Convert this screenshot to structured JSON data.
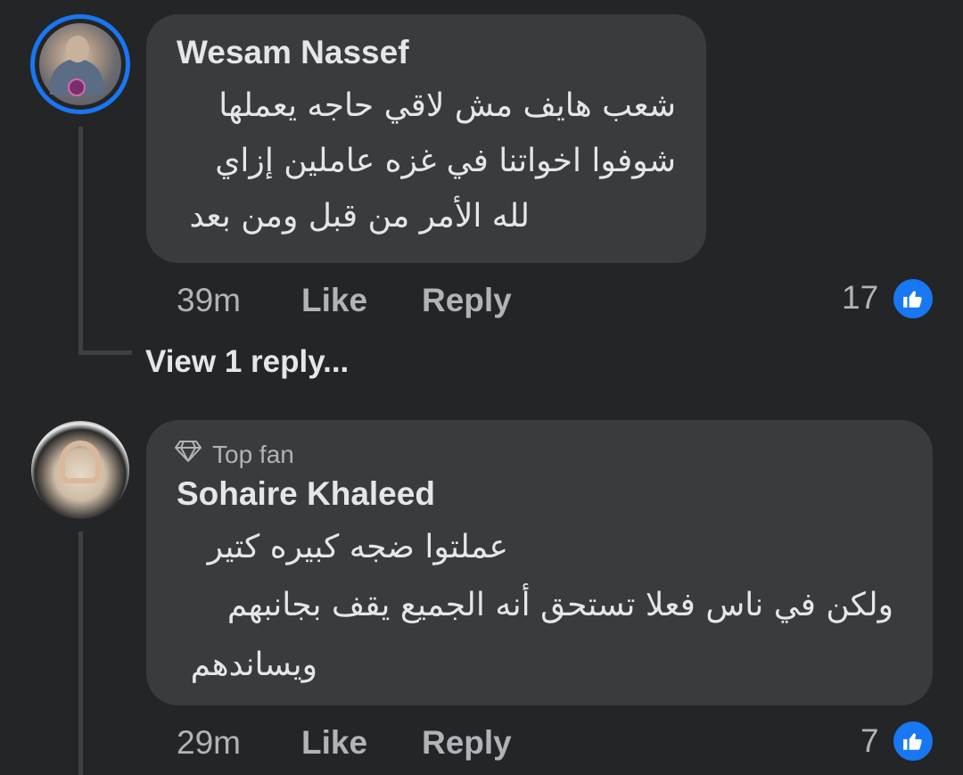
{
  "comments": [
    {
      "author": "Wesam Nassef",
      "lines": [
        "شعب هايف مش لاقي حاجه يعملها",
        "شوفوا اخواتنا في غزه عاملين إزاي",
        "لله الأمر من قبل ومن بعد"
      ],
      "time": "39m",
      "like_label": "Like",
      "reply_label": "Reply",
      "reaction_count": "17",
      "view_replies": "View 1 reply..."
    },
    {
      "badge": "Top fan",
      "author": "Sohaire Khaleed",
      "lines": [
        "عملتوا ضجه كبيره كتير",
        "ولكن في ناس فعلا تستحق أنه الجميع يقف بجانبهم",
        "ويساندهم"
      ],
      "time": "29m",
      "like_label": "Like",
      "reply_label": "Reply",
      "reaction_count": "7"
    }
  ],
  "icons": {
    "reaction": "thumbs-up-icon",
    "badge": "diamond-icon"
  },
  "colors": {
    "background": "#242526",
    "bubble": "#3a3b3c",
    "accent": "#1877f2",
    "text": "#e4e6eb",
    "muted": "#b0b3b8"
  }
}
